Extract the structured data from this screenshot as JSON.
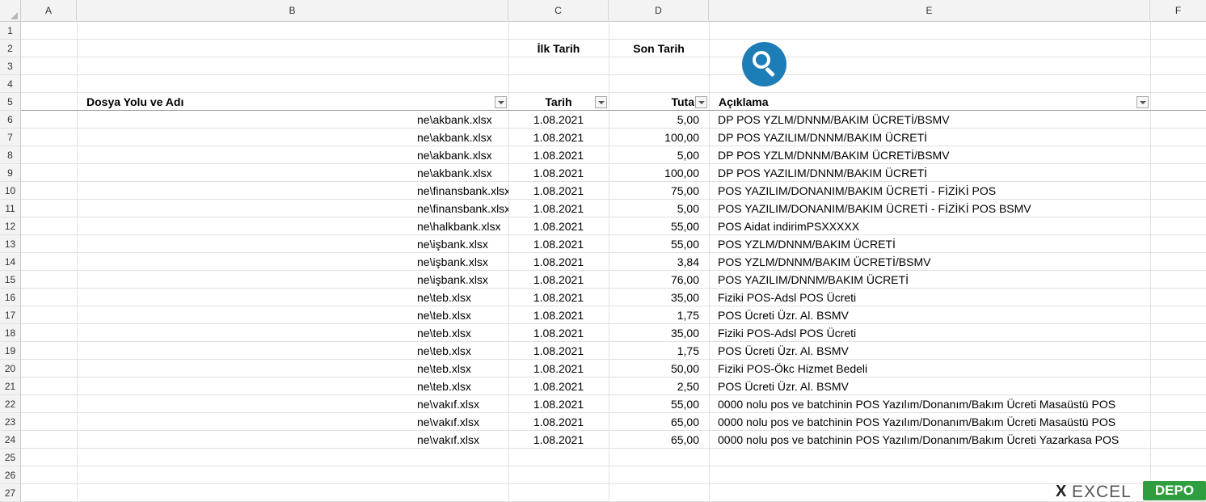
{
  "columns": [
    "A",
    "B",
    "C",
    "D",
    "E",
    "F"
  ],
  "rows": [
    "1",
    "2",
    "3",
    "4",
    "5",
    "6",
    "7",
    "8",
    "9",
    "10",
    "11",
    "12",
    "13",
    "14",
    "15",
    "16",
    "17",
    "18",
    "19",
    "20",
    "21",
    "22",
    "23",
    "24",
    "25",
    "26",
    "27"
  ],
  "header_labels": {
    "first_date": "İlk Tarih",
    "last_date": "Son Tarih"
  },
  "table_headers": {
    "file_path": "Dosya Yolu ve Adı",
    "date": "Tarih",
    "amount": "Tuta",
    "description": "Açıklama"
  },
  "icons": {
    "search": "search-icon",
    "filter": "filter-dropdown-icon"
  },
  "colors": {
    "search_button": "#1d7db7",
    "logo_green": "#2e9e3e"
  },
  "table_rows": [
    {
      "file": "ne\\akbank.xlsx",
      "date": "1.08.2021",
      "amount": "5,00",
      "desc": "DP POS YZLM/DNNM/BAKIM ÜCRETİ/BSMV"
    },
    {
      "file": "ne\\akbank.xlsx",
      "date": "1.08.2021",
      "amount": "100,00",
      "desc": "DP POS YAZILIM/DNNM/BAKIM ÜCRETİ"
    },
    {
      "file": "ne\\akbank.xlsx",
      "date": "1.08.2021",
      "amount": "5,00",
      "desc": "DP POS YZLM/DNNM/BAKIM ÜCRETİ/BSMV"
    },
    {
      "file": "ne\\akbank.xlsx",
      "date": "1.08.2021",
      "amount": "100,00",
      "desc": "DP POS YAZILIM/DNNM/BAKIM ÜCRETİ"
    },
    {
      "file": "ne\\finansbank.xlsx",
      "date": "1.08.2021",
      "amount": "75,00",
      "desc": "POS YAZILIM/DONANIM/BAKIM ÜCRETİ - FİZİKİ POS"
    },
    {
      "file": "ne\\finansbank.xlsx",
      "date": "1.08.2021",
      "amount": "5,00",
      "desc": "POS YAZILIM/DONANIM/BAKIM ÜCRETİ - FİZİKİ POS BSMV"
    },
    {
      "file": "ne\\halkbank.xlsx",
      "date": "1.08.2021",
      "amount": "55,00",
      "desc": "POS Aidat indirimPSXXXXX"
    },
    {
      "file": "ne\\işbank.xlsx",
      "date": "1.08.2021",
      "amount": "55,00",
      "desc": "POS YZLM/DNNM/BAKIM ÜCRETİ"
    },
    {
      "file": "ne\\işbank.xlsx",
      "date": "1.08.2021",
      "amount": "3,84",
      "desc": "POS YZLM/DNNM/BAKIM ÜCRETİ/BSMV"
    },
    {
      "file": "ne\\işbank.xlsx",
      "date": "1.08.2021",
      "amount": "76,00",
      "desc": "POS YAZILIM/DNNM/BAKIM ÜCRETİ"
    },
    {
      "file": "ne\\teb.xlsx",
      "date": "1.08.2021",
      "amount": "35,00",
      "desc": "Fiziki POS-Adsl POS Ücreti"
    },
    {
      "file": "ne\\teb.xlsx",
      "date": "1.08.2021",
      "amount": "1,75",
      "desc": "POS Ücreti Üzr. Al. BSMV"
    },
    {
      "file": "ne\\teb.xlsx",
      "date": "1.08.2021",
      "amount": "35,00",
      "desc": "Fiziki POS-Adsl POS Ücreti"
    },
    {
      "file": "ne\\teb.xlsx",
      "date": "1.08.2021",
      "amount": "1,75",
      "desc": "POS Ücreti Üzr. Al. BSMV"
    },
    {
      "file": "ne\\teb.xlsx",
      "date": "1.08.2021",
      "amount": "50,00",
      "desc": "Fiziki POS-Ökc Hizmet Bedeli"
    },
    {
      "file": "ne\\teb.xlsx",
      "date": "1.08.2021",
      "amount": "2,50",
      "desc": "POS Ücreti Üzr. Al. BSMV"
    },
    {
      "file": "ne\\vakıf.xlsx",
      "date": "1.08.2021",
      "amount": "55,00",
      "desc": "0000 nolu pos ve batchinin POS Yazılım/Donanım/Bakım Ücreti Masaüstü POS"
    },
    {
      "file": "ne\\vakıf.xlsx",
      "date": "1.08.2021",
      "amount": "65,00",
      "desc": "0000 nolu pos ve batchinin POS Yazılım/Donanım/Bakım Ücreti Masaüstü POS"
    },
    {
      "file": "ne\\vakıf.xlsx",
      "date": "1.08.2021",
      "amount": "65,00",
      "desc": "0000 nolu pos ve batchinin POS Yazılım/Donanım/Bakım Ücreti Yazarkasa POS"
    }
  ],
  "logo": {
    "mark": "X",
    "word": "EXCEL",
    "badge": "DEPO"
  }
}
